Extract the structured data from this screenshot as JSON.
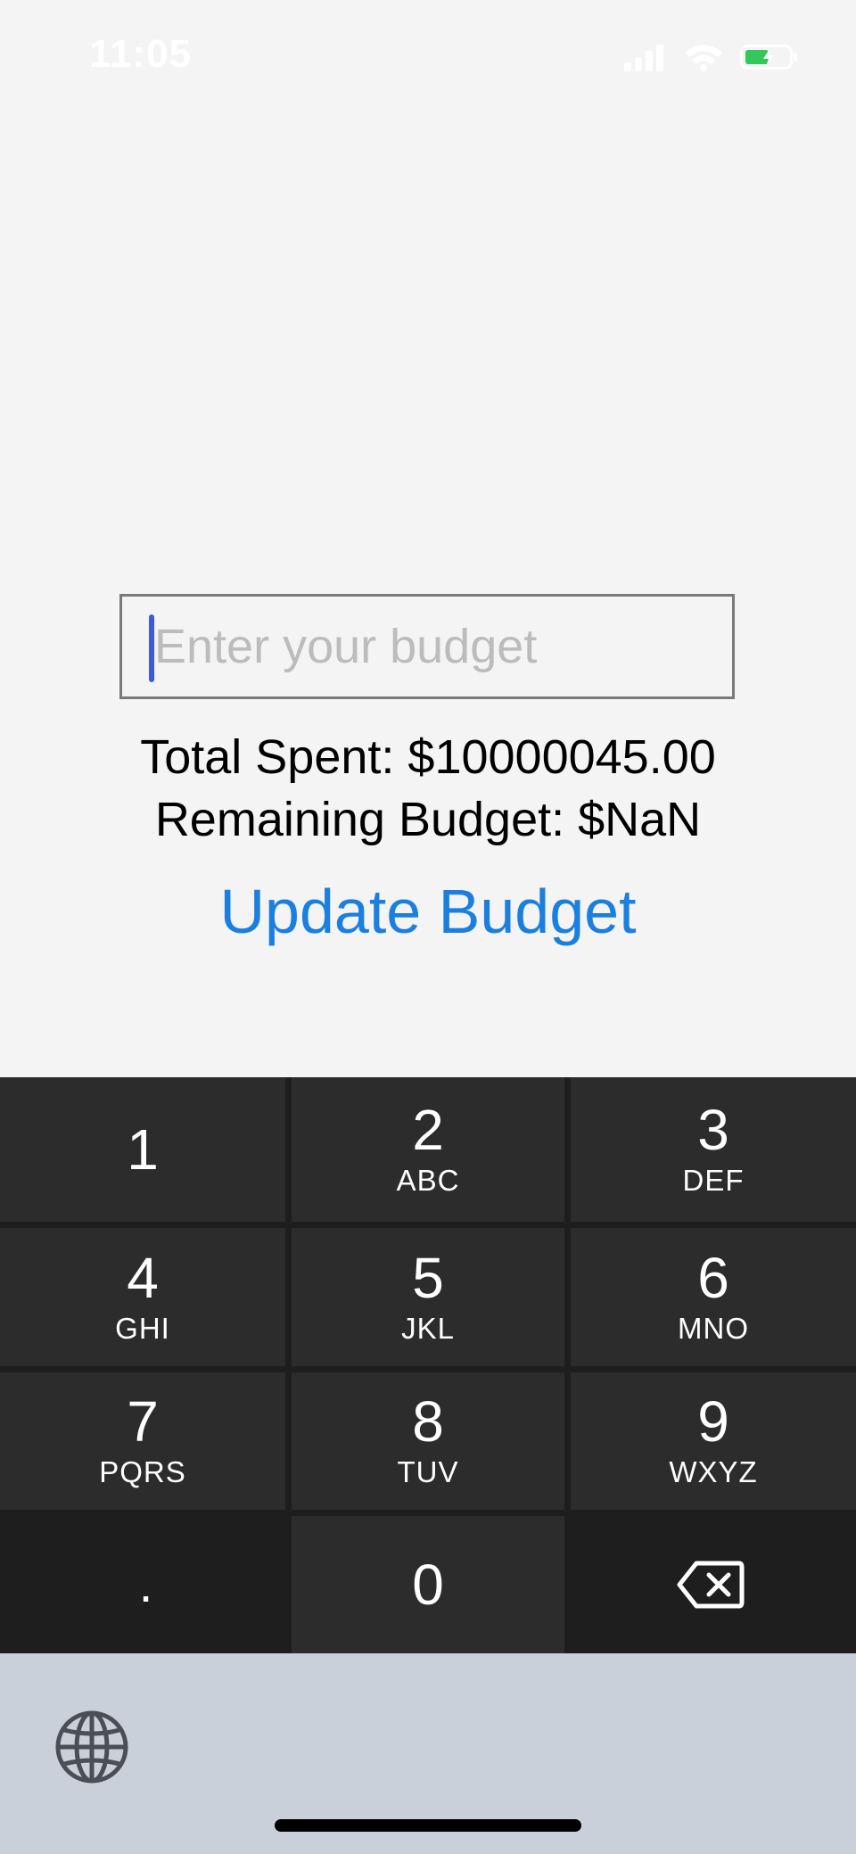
{
  "status_bar": {
    "time": "11:05",
    "signal_icon": "signal-icon",
    "wifi_icon": "wifi-icon",
    "battery_icon": "battery-charging-icon"
  },
  "budget": {
    "input_value": "",
    "input_placeholder": "Enter your budget",
    "total_spent": "Total Spent: $10000045.00",
    "remaining": "Remaining Budget: $NaN",
    "update_label": "Update Budget"
  },
  "colors": {
    "accent": "#1b7fe0",
    "cursor": "#3b5bdb",
    "keypad_bg": "#1e1e1e",
    "key_bg": "#2c2c2c",
    "footer_bg": "#c9d0da"
  },
  "keypad": {
    "keys": [
      {
        "digit": "1",
        "letters": ""
      },
      {
        "digit": "2",
        "letters": "ABC"
      },
      {
        "digit": "3",
        "letters": "DEF"
      },
      {
        "digit": "4",
        "letters": "GHI"
      },
      {
        "digit": "5",
        "letters": "JKL"
      },
      {
        "digit": "6",
        "letters": "MNO"
      },
      {
        "digit": "7",
        "letters": "PQRS"
      },
      {
        "digit": "8",
        "letters": "TUV"
      },
      {
        "digit": "9",
        "letters": "WXYZ"
      }
    ],
    "period": ".",
    "zero": "0",
    "backspace_icon": "backspace-icon"
  },
  "footer": {
    "globe_icon": "globe-icon"
  }
}
